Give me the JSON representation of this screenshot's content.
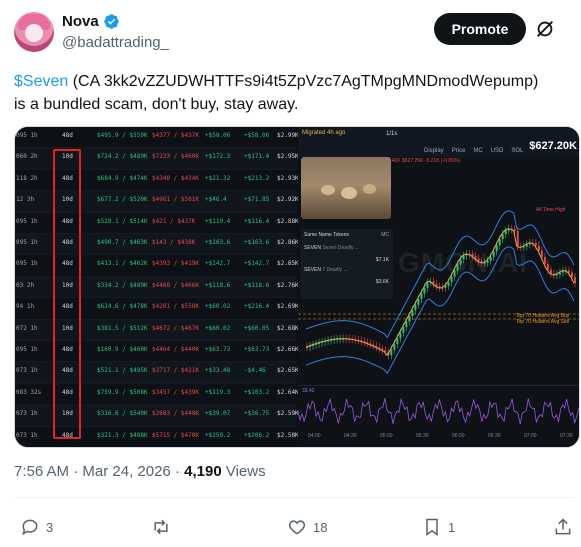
{
  "author": {
    "display_name": "Nova",
    "handle": "@badattrading_"
  },
  "header": {
    "promote_label": "Promote"
  },
  "tweet": {
    "cashtag": "$Seven",
    "line1_rest": " (CA 3kk2vZZUDWHTTFs9i4t5ZpVzc7AgTMpgMNDmodWepump)",
    "line2": "is a bundled scam, don't buy, stay away."
  },
  "media": {
    "left_rows": [
      {
        "c0": "095 1h",
        "c1": "48d",
        "c2": "$495.9 / $559K",
        "c3": "$4377 / $437K",
        "c4": "+$58.06",
        "c5": "+$58.06",
        "c6": "$2.99K"
      },
      {
        "c0": "060 2h",
        "c1": "10d",
        "c2": "$724.2 / $489K",
        "c3": "$7233 / $460K",
        "c4": "+$172.3",
        "c5": "+$171.4",
        "c6": "$2.95K"
      },
      {
        "c0": "118 2h",
        "c1": "48d",
        "c2": "$684.9 / $474K",
        "c3": "$4348 / $434K",
        "c4": "+$21.32",
        "c5": "+$213.2",
        "c6": "$2.93K"
      },
      {
        "c0": "12 3h",
        "c1": "10d",
        "c2": "$677.2 / $520K",
        "c3": "$4961 / $501K",
        "c4": "+$46.4",
        "c5": "+$71.85",
        "c6": "$2.92K"
      },
      {
        "c0": "095 1h",
        "c1": "48d",
        "c2": "$528.1 / $514K",
        "c3": "$421 / $437K",
        "c4": "+$110.4",
        "c5": "+$116.4",
        "c6": "$2.88K"
      },
      {
        "c0": "095 1h",
        "c1": "48d",
        "c2": "$490.7 / $463K",
        "c3": "$143 / $438K",
        "c4": "+$163.6",
        "c5": "+$163.6",
        "c6": "$2.86K"
      },
      {
        "c0": "095 1h",
        "c1": "48d",
        "c2": "$413.1 / $462K",
        "c3": "$4393 / $419K",
        "c4": "+$142.7",
        "c5": "+$142.7",
        "c6": "$2.85K"
      },
      {
        "c0": "03 2h",
        "c1": "10d",
        "c2": "$334.2 / $489K",
        "c3": "$4468 / $466K",
        "c4": "+$118.6",
        "c5": "+$118.6",
        "c6": "$2.76K"
      },
      {
        "c0": "94 1h",
        "c1": "48d",
        "c2": "$624.6 / $478K",
        "c3": "$4201 / $558K",
        "c4": "+$60.02",
        "c5": "+$216.4",
        "c6": "$2.69K"
      },
      {
        "c0": "072 1h",
        "c1": "10d",
        "c2": "$381.5 / $512K",
        "c3": "$4672 / $467K",
        "c4": "+$60.02",
        "c5": "+$60.05",
        "c6": "$2.68K"
      },
      {
        "c0": "095 1h",
        "c1": "48d",
        "c2": "$160.9 / $460K",
        "c3": "$4464 / $440K",
        "c4": "+$63.73",
        "c5": "+$63.73",
        "c6": "$2.66K"
      },
      {
        "c0": "073 1h",
        "c1": "48d",
        "c2": "$521.1 / $495K",
        "c3": "$3717 / $421K",
        "c4": "+$33.48",
        "c5": "-$4.46",
        "c6": "$2.65K"
      },
      {
        "c0": "083 32s",
        "c1": "48d",
        "c2": "$759.9 / $508K",
        "c3": "$3457 / $439K",
        "c4": "+$119.3",
        "c5": "+$103.2",
        "c6": "$2.64K"
      },
      {
        "c0": "073 1h",
        "c1": "10d",
        "c2": "$316.6 / $540K",
        "c3": "$2683 / $448K",
        "c4": "+$39.07",
        "c5": "+$36.75",
        "c6": "$2.59K"
      },
      {
        "c0": "073 1h",
        "c1": "48d",
        "c2": "$321.3 / $488K",
        "c3": "$5715 / $478K",
        "c4": "+$259.2",
        "c5": "+$206.2",
        "c6": "$2.58K"
      }
    ],
    "chart": {
      "price_label": "$627.20K",
      "migrated_label": "Migrated 4h ago",
      "timeframe": "1/1s",
      "toolbar": [
        "Display",
        "Price",
        "MC",
        "USD",
        "SOL"
      ],
      "ohlc_line": "$18.40K  $627.25K  -5.21K (-0.86%)",
      "watermark": "GMGN.AI",
      "ath_label": "All Time High",
      "avg_buy_label": "Top 70 Holders Avg Buy",
      "avg_sell_label": "Top 70 Holders Avg Sell",
      "token_list_header": "Same Name Tokens",
      "token_list_col": "MC",
      "tokens": [
        {
          "name": "SEVEN",
          "sub": "Seven Deadly ...",
          "mc": "$7.1K"
        },
        {
          "name": "SEVEN",
          "sub": "7 Deadly ...",
          "mc": "$3.6K"
        }
      ],
      "indicator_value": "33.42",
      "time_ticks": [
        "04:00",
        "04:30",
        "05:00",
        "05:30",
        "06:00",
        "06:30",
        "07:00",
        "07:30"
      ]
    }
  },
  "meta": {
    "time": "7:56 AM",
    "sep": " · ",
    "date": "Mar 24, 2026",
    "views_count": "4,190",
    "views_label": " Views"
  },
  "actions": {
    "replies": "3",
    "reposts": "",
    "likes": "18",
    "bookmarks": "1"
  },
  "colors": {
    "accent": "#1d9bf0",
    "up": "#26c281",
    "down": "#e5484d",
    "highlight": "#e0242b"
  }
}
